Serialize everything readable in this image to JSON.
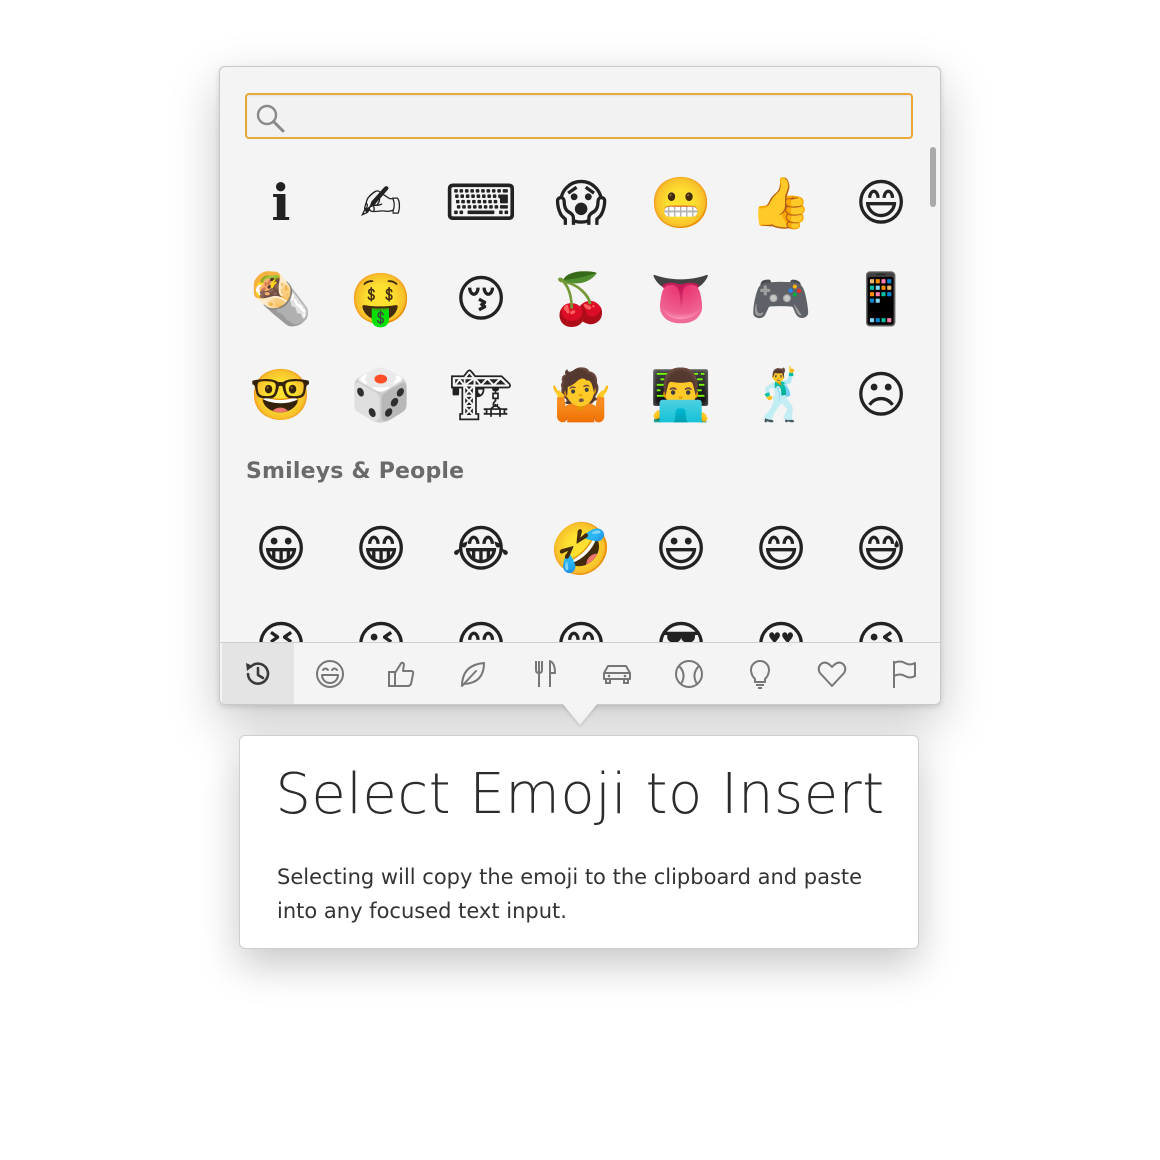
{
  "search": {
    "placeholder": "",
    "value": "",
    "accent_color": "#e8a83c"
  },
  "recent_emojis": [
    [
      "ℹ",
      "✍",
      "⌨",
      "😱",
      "😬",
      "👍",
      "😄"
    ],
    [
      "🌯",
      "🤑",
      "😚",
      "🍒",
      "👅",
      "🎮",
      "📱"
    ],
    [
      "🤓",
      "🎲",
      "🏗",
      "🤷",
      "👨‍💻",
      "🕺",
      "☹"
    ]
  ],
  "section": {
    "title": "Smileys & People"
  },
  "smileys": [
    [
      "😀",
      "😁",
      "😂",
      "🤣",
      "😃",
      "😄",
      "😅"
    ],
    [
      "😆",
      "😉",
      "😊",
      "😋",
      "😎",
      "😍",
      "😘"
    ]
  ],
  "categories": [
    {
      "icon": "history-icon",
      "label": "Recent",
      "active": true
    },
    {
      "icon": "smiley-icon",
      "label": "Smileys & People"
    },
    {
      "icon": "thumbs-up-icon",
      "label": "Gestures"
    },
    {
      "icon": "leaf-icon",
      "label": "Animals & Nature"
    },
    {
      "icon": "fork-knife-icon",
      "label": "Food & Drink"
    },
    {
      "icon": "car-icon",
      "label": "Travel & Places"
    },
    {
      "icon": "ball-icon",
      "label": "Activities"
    },
    {
      "icon": "lightbulb-icon",
      "label": "Objects"
    },
    {
      "icon": "heart-icon",
      "label": "Symbols"
    },
    {
      "icon": "flag-icon",
      "label": "Flags"
    }
  ],
  "info": {
    "title": "Select Emoji to Insert",
    "body": "Selecting will copy the emoji to the clipboard and paste into any focused text input."
  }
}
